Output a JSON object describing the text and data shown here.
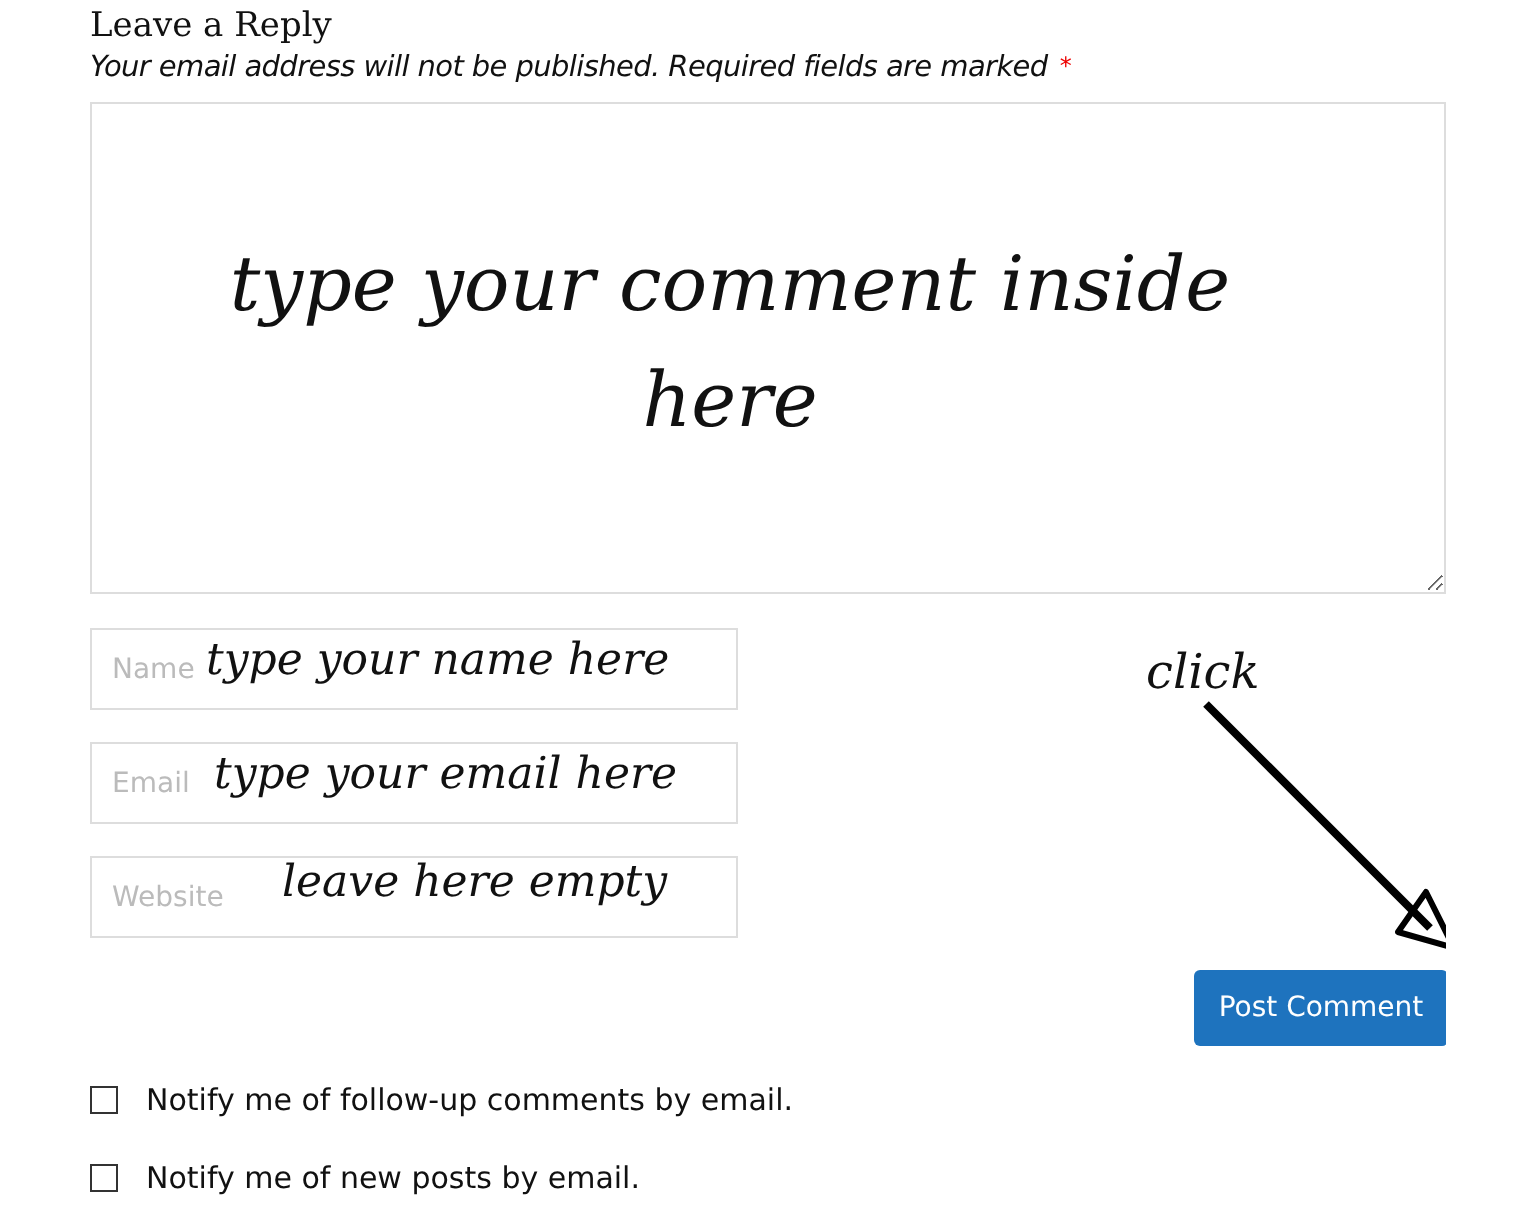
{
  "heading": "Leave a Reply",
  "notice": {
    "text": "Your email address will not be published. Required fields are marked",
    "required_mark": "*"
  },
  "comment_box": {
    "note": "type your comment inside here"
  },
  "fields": [
    {
      "placeholder": "Name",
      "note": "type your name here"
    },
    {
      "placeholder": "Email",
      "note": "type your email here"
    },
    {
      "placeholder": "Website",
      "note": "leave here empty"
    }
  ],
  "click_note": "click",
  "submit": "Post Comment",
  "options": [
    {
      "label": "Notify me of follow-up comments by email.",
      "checked": false
    },
    {
      "label": "Notify me of new posts by email.",
      "checked": false
    }
  ]
}
